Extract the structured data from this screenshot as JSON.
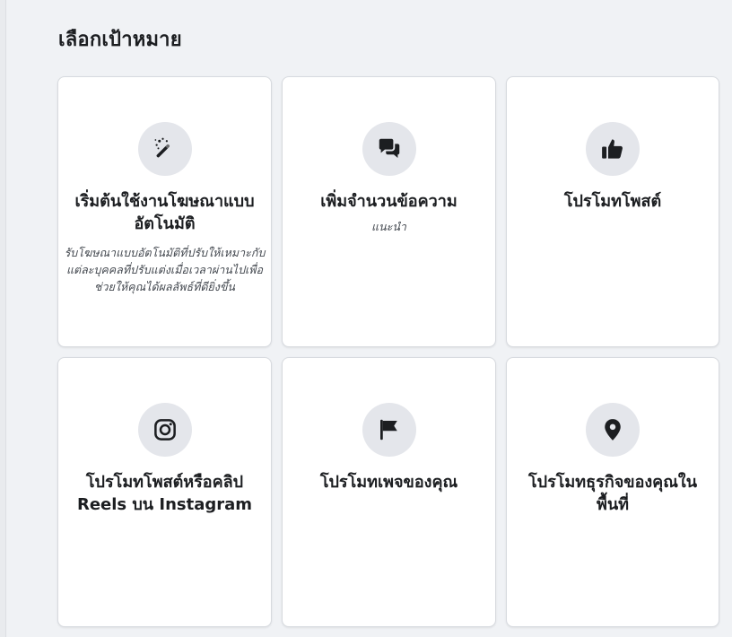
{
  "header": {
    "title": "เลือกเป้าหมาย"
  },
  "cards": [
    {
      "title": "เริ่มต้นใช้งานโฆษณาแบบอัตโนมัติ",
      "subtitle": "รับโฆษณาแบบอัตโนมัติที่ปรับให้เหมาะกับแต่ละบุคคลที่ปรับแต่งเมื่อเวลาผ่านไปเพื่อช่วยให้คุณได้ผลลัพธ์ที่ดียิ่งขึ้น",
      "icon": "magic-wand-icon"
    },
    {
      "title": "เพิ่มจำนวนข้อความ",
      "subtitle": "แนะนำ",
      "icon": "chat-bubbles-icon"
    },
    {
      "title": "โปรโมทโพสต์",
      "icon": "thumbs-up-icon"
    },
    {
      "title": "โปรโมทโพสต์หรือคลิป Reels บน Instagram",
      "icon": "instagram-icon"
    },
    {
      "title": "โปรโมทเพจของคุณ",
      "icon": "flag-icon"
    },
    {
      "title": "โปรโมทธุรกิจของคุณในพื้นที่",
      "icon": "map-pin-icon"
    }
  ],
  "colors": {
    "background": "#f0f2f5",
    "card": "#ffffff",
    "icon_circle": "#e4e6eb",
    "icon": "#1c1e21",
    "text": "#1c1e21"
  }
}
